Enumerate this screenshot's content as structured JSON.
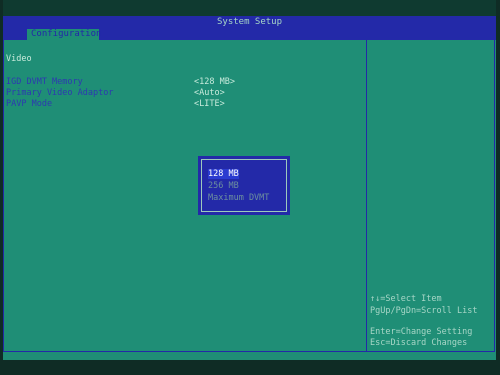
{
  "header": {
    "title": "System Setup"
  },
  "tabs": [
    {
      "label": "Configuration"
    }
  ],
  "section": {
    "title": "Video"
  },
  "settings": [
    {
      "label": "IGD DVMT Memory",
      "value": "<128 MB>"
    },
    {
      "label": "Primary Video Adaptor",
      "value": "<Auto>"
    },
    {
      "label": "PAVP Mode",
      "value": "<LITE>"
    }
  ],
  "popup": {
    "options": [
      "128 MB",
      "256 MB",
      "Maximum DVMT"
    ],
    "selected_index": 0
  },
  "help": {
    "lines": [
      "↑↓=Select Item",
      "PgUp/PgDn=Scroll List",
      "Enter=Change Setting",
      "Esc=Discard Changes"
    ]
  },
  "colors": {
    "background": "#1f8e76",
    "accent": "#2329a8",
    "highlight": "#2b3bd0"
  }
}
